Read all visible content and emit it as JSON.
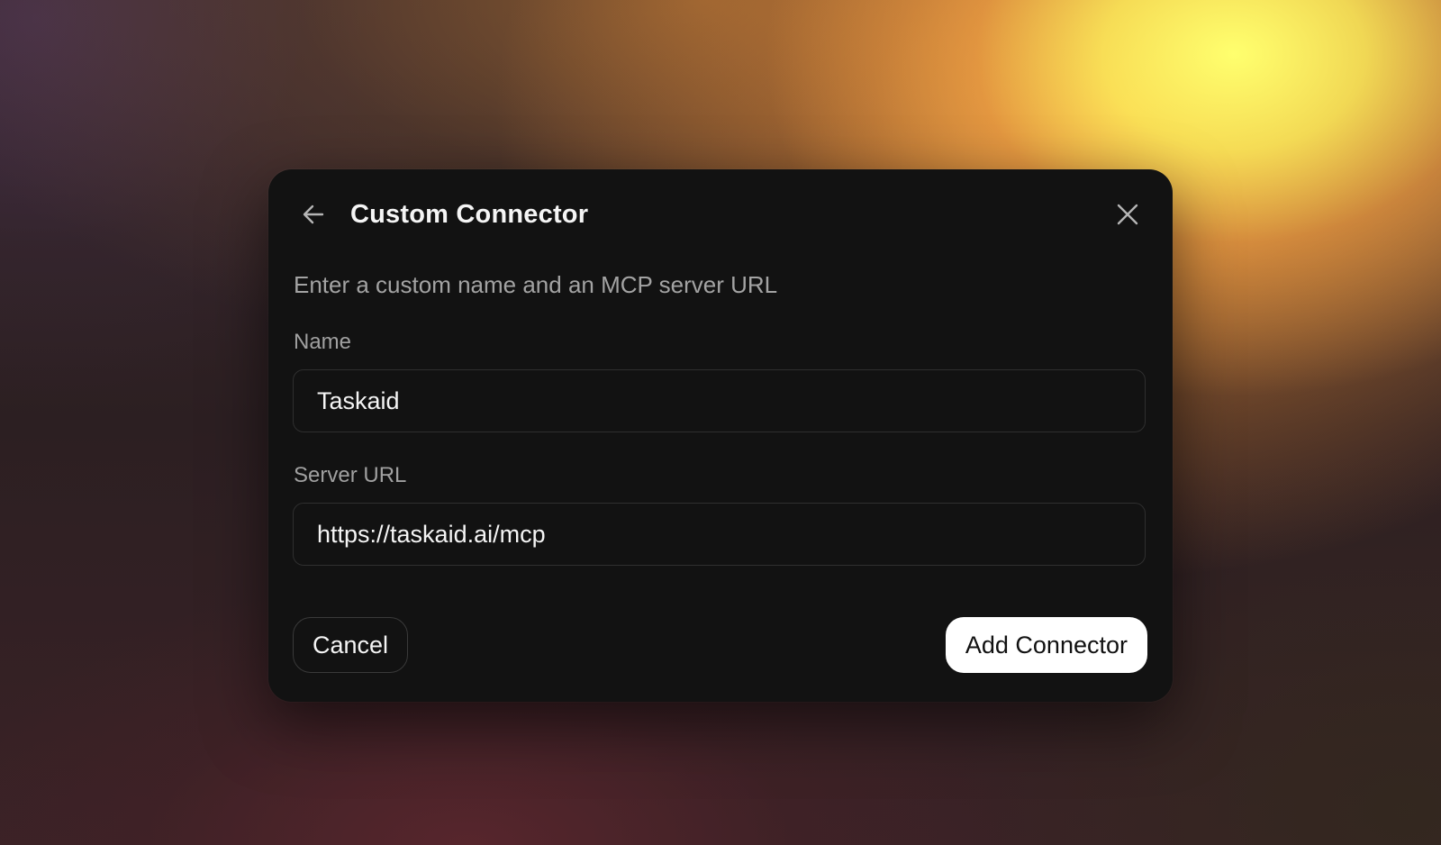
{
  "dialog": {
    "title": "Custom Connector",
    "subtitle": "Enter a custom name and an MCP server URL",
    "back_icon": "arrow-left-icon",
    "close_icon": "close-icon"
  },
  "form": {
    "name": {
      "label": "Name",
      "value": "Taskaid"
    },
    "server_url": {
      "label": "Server URL",
      "value": "https://taskaid.ai/mcp"
    }
  },
  "actions": {
    "cancel_label": "Cancel",
    "add_label": "Add Connector"
  },
  "colors": {
    "dialog_background": "#121212",
    "primary_button_background": "#ffffff",
    "primary_button_text": "#111111",
    "muted_text": "#a3a3a3"
  }
}
